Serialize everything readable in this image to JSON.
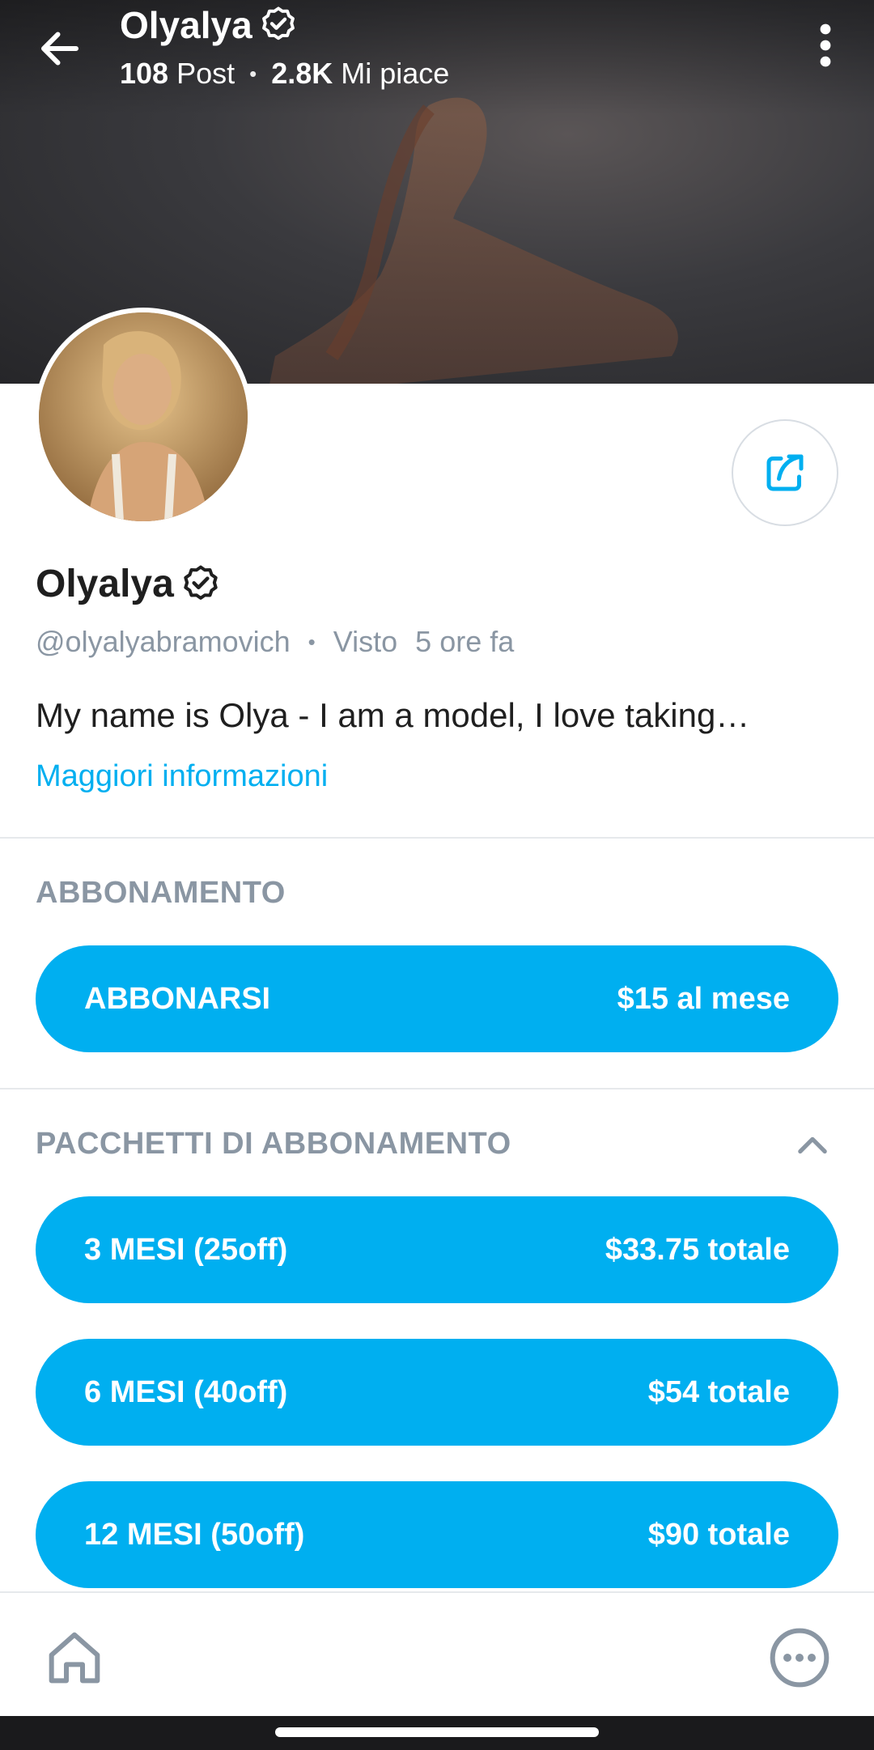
{
  "header": {
    "title": "Olyalya",
    "posts_count": "108",
    "posts_label": "Post",
    "likes_count": "2.8K",
    "likes_label": "Mi piace",
    "separator": "•"
  },
  "profile": {
    "name": "Olyalya",
    "username": "@olyalyabramovich",
    "separator": "•",
    "seen_label": "Visto",
    "seen_time": "5 ore fa",
    "bio": "My name is Olya - I am a model, I love taking…",
    "more_info_link": "Maggiori informazioni"
  },
  "subscription": {
    "section_title": "ABBONAMENTO",
    "button_label": "ABBONARSI",
    "button_price": "$15 al mese"
  },
  "bundles": {
    "section_title": "PACCHETTI DI ABBONAMENTO",
    "items": [
      {
        "label": "3 MESI (25off)",
        "price": "$33.75 totale"
      },
      {
        "label": "6 MESI (40off)",
        "price": "$54 totale"
      },
      {
        "label": "12 MESI (50off)",
        "price": "$90 totale"
      }
    ]
  },
  "icons": {
    "back": "arrow-left-icon",
    "verified": "verified-badge-icon",
    "more": "more-vertical-icon",
    "share": "share-icon",
    "collapse": "chevron-up-icon",
    "home": "home-icon",
    "more_menu": "more-circle-icon"
  },
  "colors": {
    "accent": "#00aff0",
    "muted_text": "#8a96a3",
    "primary_text": "#1f1f1f"
  }
}
